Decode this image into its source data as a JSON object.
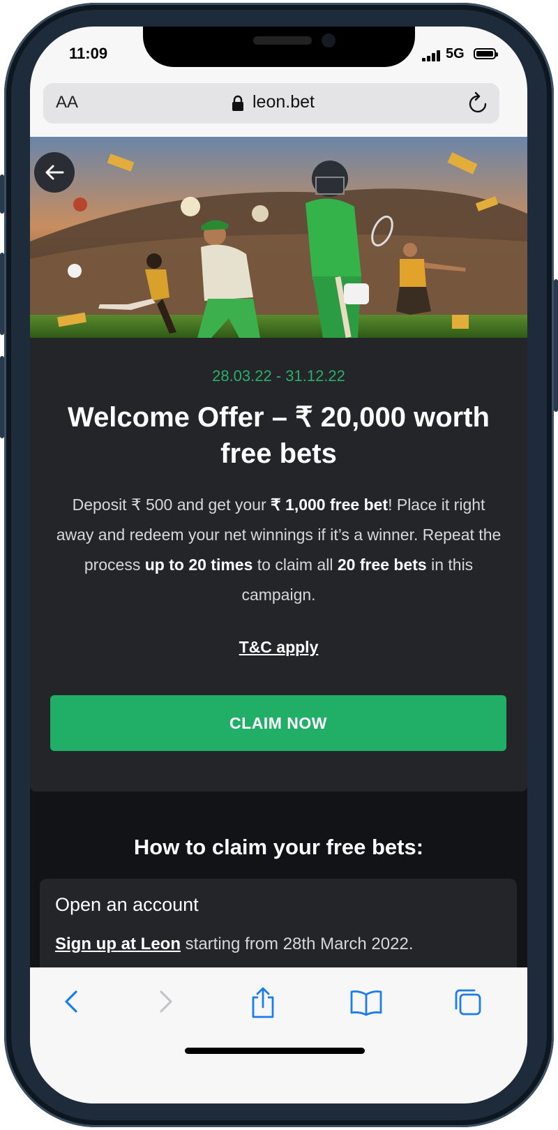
{
  "status_bar": {
    "time": "11:09",
    "network": "5G"
  },
  "browser": {
    "text_size_label": "AA",
    "domain": "leon.bet"
  },
  "promo": {
    "dates": "28.03.22 - 31.12.22",
    "title": "Welcome Offer – ₹ 20,000 worth free bets",
    "desc": {
      "p1": "Deposit ₹ 500 and get your ",
      "b1": "₹ 1,000 free bet",
      "p2": "! Place it right away and redeem your net winnings if it’s a winner. Repeat the process ",
      "b2": "up to 20 times",
      "p3": " to claim all ",
      "b3": "20 free bets",
      "p4": " in this campaign."
    },
    "tc_link": "T&C apply",
    "claim_button": "CLAIM NOW"
  },
  "how_to": {
    "heading": "How to claim your free bets:",
    "step1": {
      "title": "Open an account",
      "link": "Sign up at Leon",
      "text": " starting from 28th March 2022."
    }
  },
  "colors": {
    "accent_green": "#21af68",
    "date_green": "#2aae6a",
    "card_bg": "#232529",
    "page_bg": "#111316",
    "ios_blue": "#1a7cf0"
  },
  "icons": [
    "back-arrow-icon",
    "lock-icon",
    "reload-icon",
    "nav-back-icon",
    "nav-forward-icon",
    "share-icon",
    "bookmarks-icon",
    "tabs-icon"
  ]
}
